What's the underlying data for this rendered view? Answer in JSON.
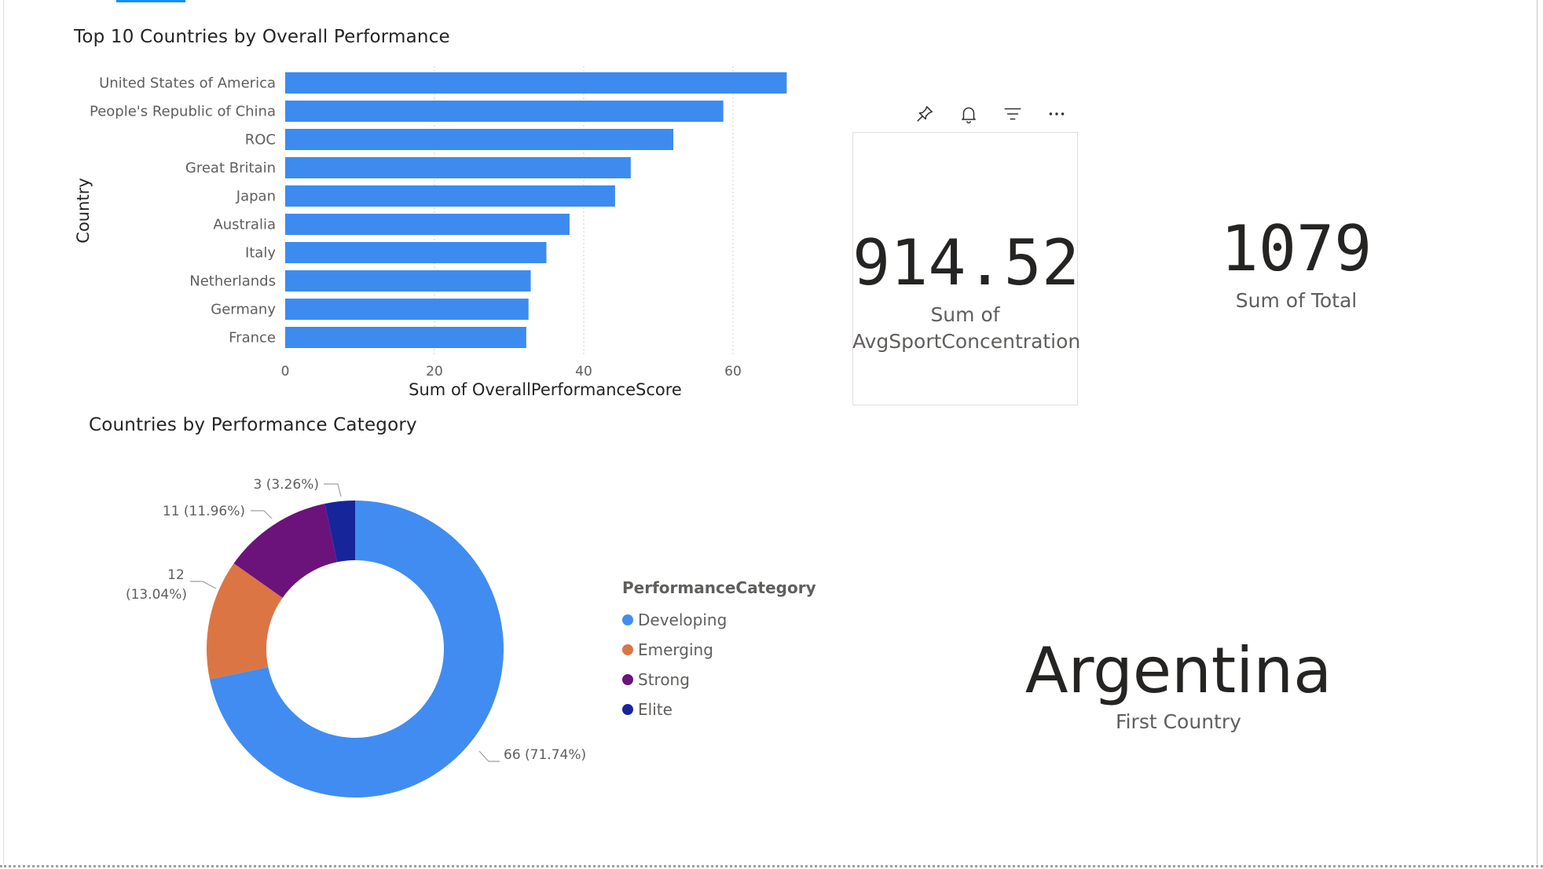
{
  "bar_chart": {
    "title": "Top 10 Countries by Overall Performance"
  },
  "donut_chart": {
    "title": "Countries by Performance Category",
    "legend_title": "PerformanceCategory"
  },
  "card_avg": {
    "value": "914.52",
    "label_line1": "Sum of",
    "label_line2": "AvgSportConcentration",
    "header_icons": [
      "pin-icon",
      "bell-icon",
      "filter-icon",
      "more-options-icon"
    ]
  },
  "card_total": {
    "value": "1079",
    "label": "Sum of Total"
  },
  "card_first": {
    "value": "Argentina",
    "label": "First Country"
  },
  "colors": {
    "bar": "#3d8bef",
    "developing": "#418cf0",
    "emerging": "#dc7544",
    "strong": "#6b137a",
    "elite": "#16259a"
  },
  "chart_data": [
    {
      "type": "bar",
      "orientation": "horizontal",
      "title": "Top 10 Countries by Overall Performance",
      "xlabel": "Sum of OverallPerformanceScore",
      "ylabel": "Country",
      "categories": [
        "United States of America",
        "People's Republic of China",
        "ROC",
        "Great Britain",
        "Japan",
        "Australia",
        "Italy",
        "Netherlands",
        "Germany",
        "France"
      ],
      "values": [
        67.2,
        58.7,
        52,
        46.3,
        44.2,
        38.1,
        35,
        32.9,
        32.6,
        32.3
      ],
      "xlim": [
        0,
        70
      ],
      "xticks": [
        "0",
        "20",
        "40",
        "60"
      ],
      "grid": true
    },
    {
      "type": "pie",
      "variant": "donut",
      "title": "Countries by Performance Category",
      "legend_title": "PerformanceCategory",
      "slices": [
        {
          "name": "Developing",
          "value": 66,
          "label": "66 (71.74%)"
        },
        {
          "name": "Emerging",
          "value": 12,
          "label_line1": "12",
          "label_line2": "(13.04%)"
        },
        {
          "name": "Strong",
          "value": 11,
          "label": "11 (11.96%)"
        },
        {
          "name": "Elite",
          "value": 3,
          "label": "3 (3.26%)"
        }
      ],
      "legend_position": "right"
    }
  ]
}
